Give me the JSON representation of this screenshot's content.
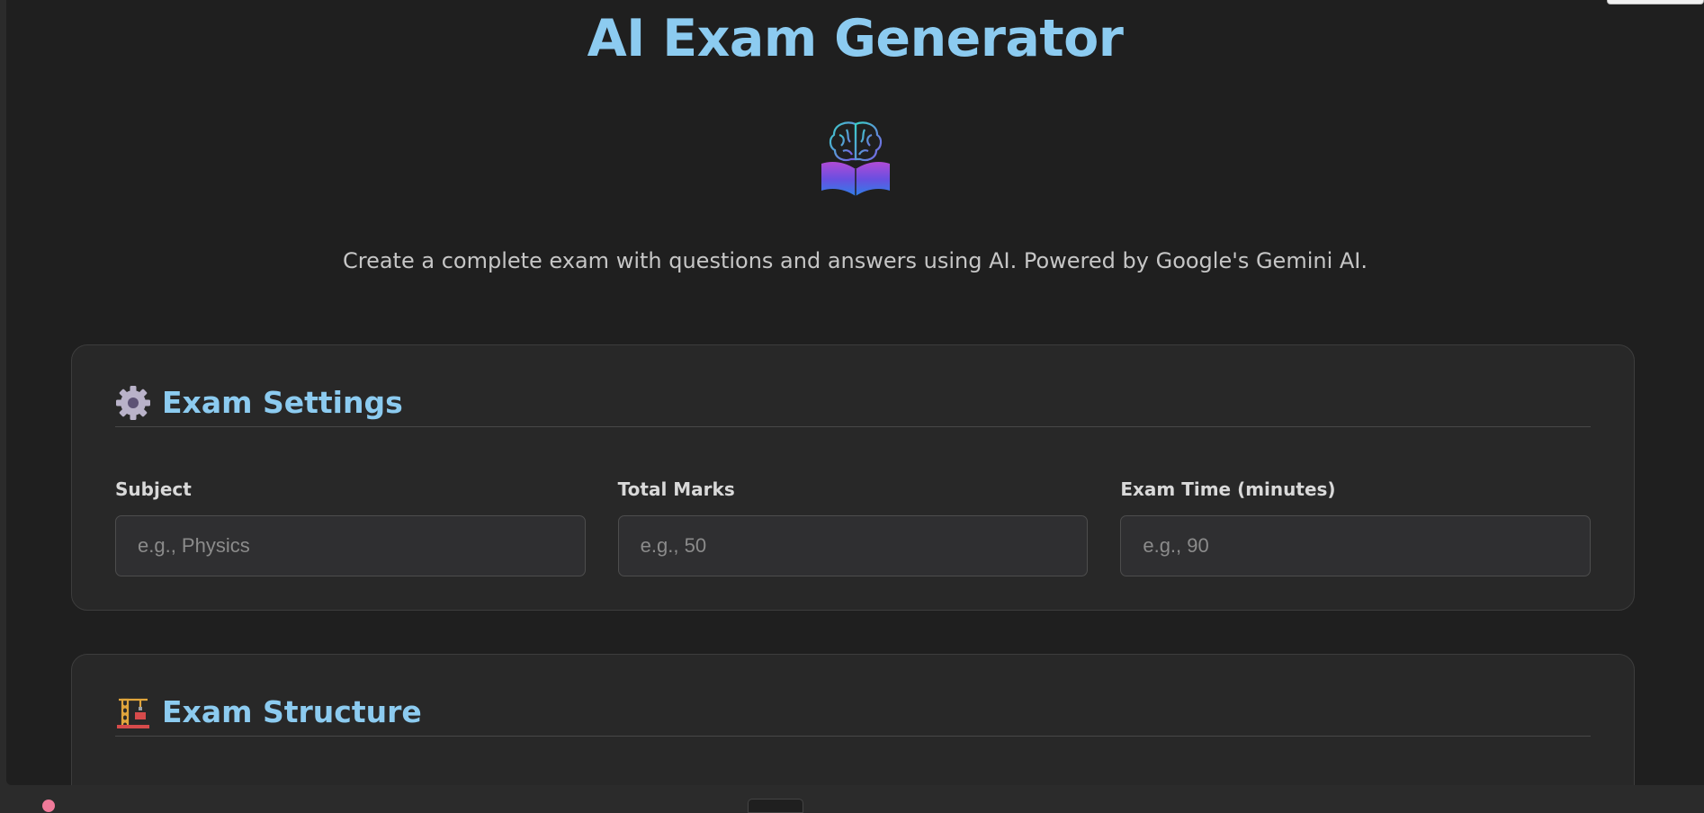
{
  "header": {
    "title": "AI Exam Generator",
    "subtitle": "Create a complete exam with questions and answers using AI. Powered by Google's Gemini AI.",
    "logo_icon": "brain-book-icon"
  },
  "settings": {
    "icon": "gear-icon",
    "heading": "Exam Settings",
    "fields": [
      {
        "label": "Subject",
        "placeholder": "e.g., Physics",
        "value": ""
      },
      {
        "label": "Total Marks",
        "placeholder": "e.g., 50",
        "value": ""
      },
      {
        "label": "Exam Time (minutes)",
        "placeholder": "e.g., 90",
        "value": ""
      }
    ]
  },
  "structure": {
    "icon": "construction-crane-icon",
    "heading": "Exam Structure"
  },
  "colors": {
    "accent": "#8ccbf0",
    "background": "#1f1f1f",
    "card": "#282828"
  }
}
